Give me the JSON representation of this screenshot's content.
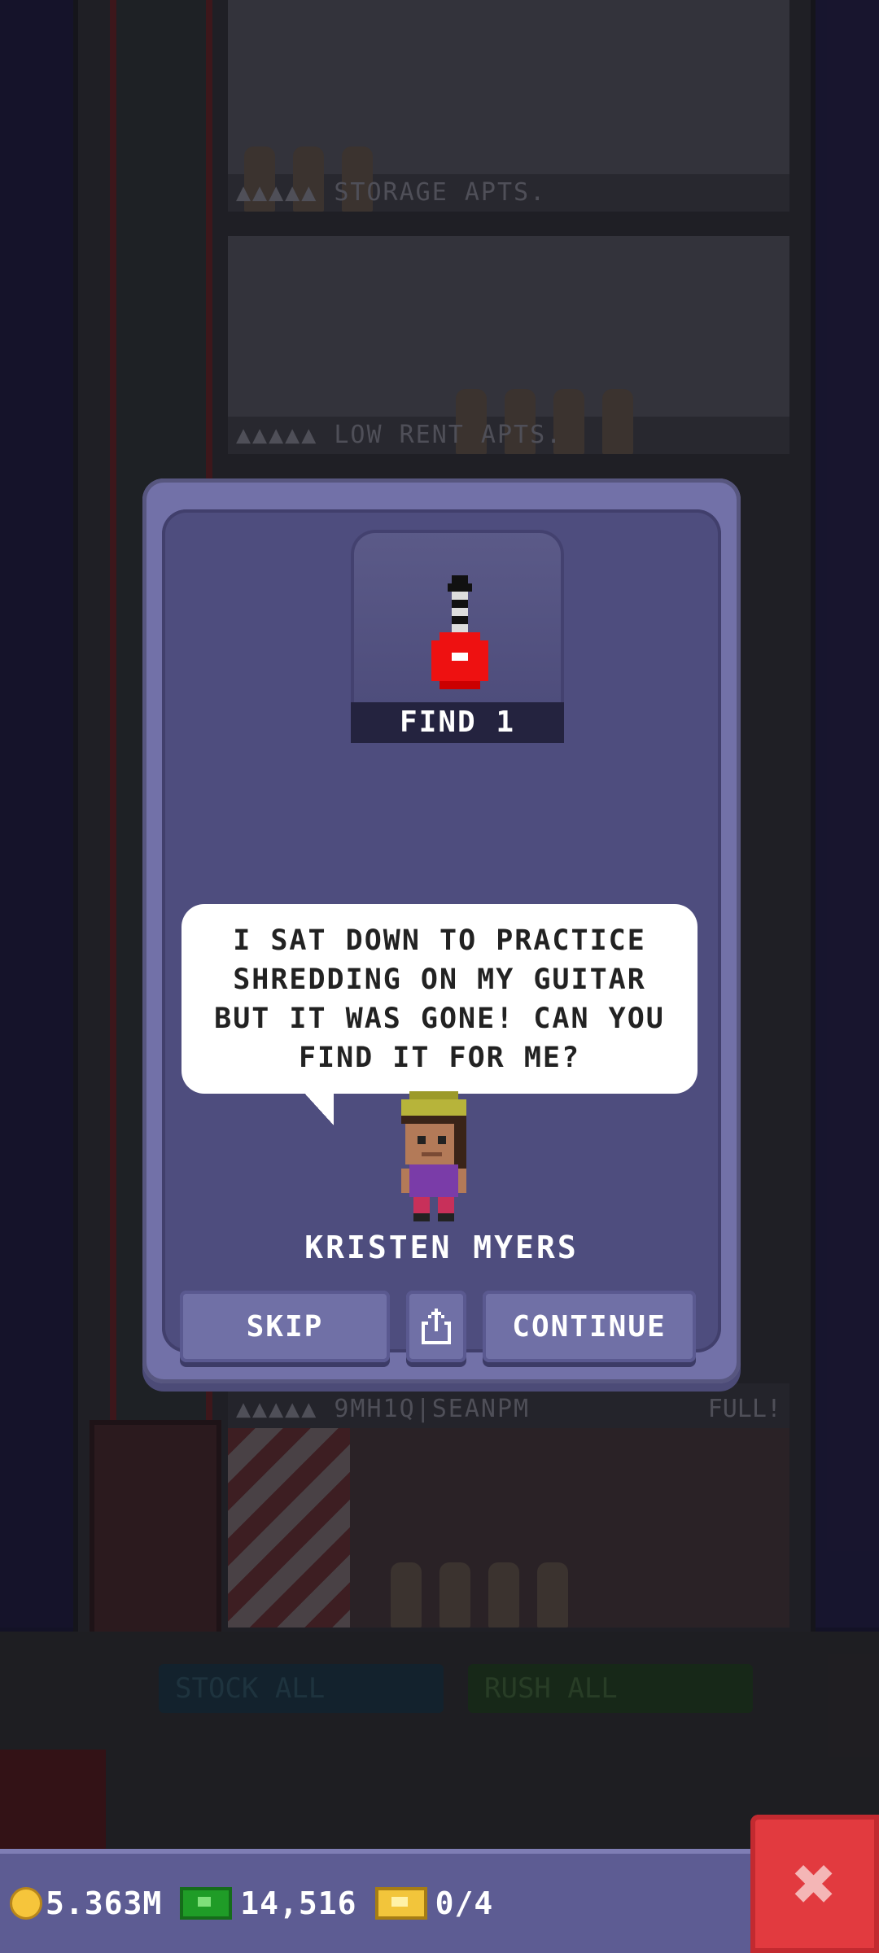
{
  "background": {
    "floors": [
      {
        "label": "▲▲▲▲▲ STORAGE APTS.",
        "full": ""
      },
      {
        "label": "▲▲▲▲▲ LOW RENT APTS.",
        "full": ""
      },
      {
        "label": "▲▲▲▲▲ 9MH1Q|SEANPM",
        "full": "FULL!"
      }
    ],
    "stock_all": "STOCK ALL",
    "rush_all": "RUSH ALL"
  },
  "dialog": {
    "quest_label": "FIND 1",
    "quest_item_icon": "guitar-icon",
    "message": "I SAT DOWN TO PRACTICE SHREDDING ON MY GUITAR BUT IT WAS GONE! CAN YOU FIND IT FOR ME?",
    "character_name": "KRISTEN MYERS",
    "skip_label": "SKIP",
    "share_icon": "share-icon",
    "continue_label": "CONTINUE"
  },
  "status": {
    "coins": "5.363M",
    "bux": "14,516",
    "tickets": "0/4",
    "close_icon": "close-icon"
  },
  "colors": {
    "modal": "#7271a8",
    "modal_inner": "#4e4d7e",
    "button": "#7070a6",
    "close": "#e23a3f"
  }
}
